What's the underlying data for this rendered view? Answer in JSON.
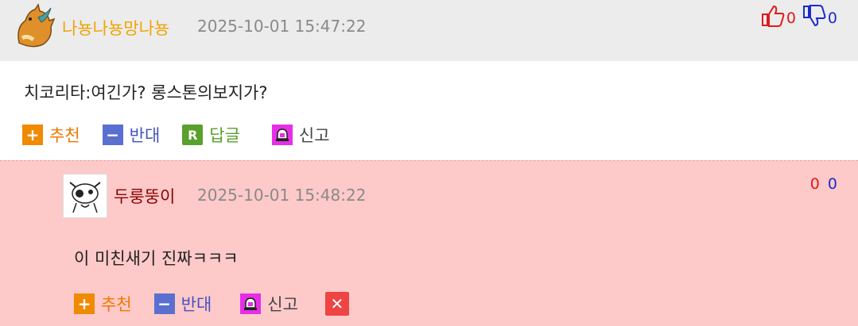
{
  "comments": [
    {
      "nickname": "나뇽나뇽망나뇽",
      "time": "2025-10-01 15:47:22",
      "up": "0",
      "down": "0",
      "text": "치코리타:여긴가? 롱스톤의보지가?",
      "actions": {
        "recommend": "추천",
        "oppose": "반대",
        "reply": "답글",
        "report": "신고"
      }
    },
    {
      "nickname": "두룽뚱이",
      "time": "2025-10-01 15:48:22",
      "up": "0",
      "down": "0",
      "text": "이 미친새기 진짜ㅋㅋㅋ",
      "actions": {
        "recommend": "추천",
        "oppose": "반대",
        "report": "신고"
      }
    }
  ],
  "icons": {
    "plus": "+",
    "minus": "−",
    "reply": "R",
    "delete": "✕"
  },
  "colors": {
    "nick1": "#f0a400",
    "nick2": "#8b0000",
    "reply_bg": "#fdc9c9",
    "up": "#e01a1a",
    "down": "#1b2cc9"
  }
}
